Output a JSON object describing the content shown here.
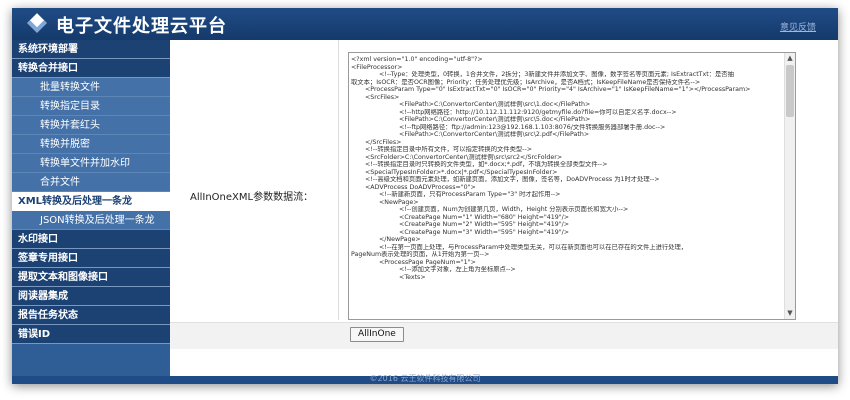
{
  "header": {
    "title": "电子文件处理云平台",
    "feedback_label": "意见反馈"
  },
  "sidebar": {
    "items": [
      {
        "label": "系统环境部署",
        "type": "top"
      },
      {
        "label": "转换合并接口",
        "type": "top"
      },
      {
        "label": "批量转换文件",
        "type": "sub"
      },
      {
        "label": "转换指定目录",
        "type": "sub"
      },
      {
        "label": "转换并套红头",
        "type": "sub"
      },
      {
        "label": "转换并脱密",
        "type": "sub"
      },
      {
        "label": "转换单文件并加水印",
        "type": "sub"
      },
      {
        "label": "合并文件",
        "type": "sub"
      },
      {
        "label": "XML转换及后处理一条龙",
        "type": "active"
      },
      {
        "label": "JSON转换及后处理一条龙",
        "type": "sub"
      },
      {
        "label": "水印接口",
        "type": "top"
      },
      {
        "label": "签章专用接口",
        "type": "top"
      },
      {
        "label": "提取文本和图像接口",
        "type": "top"
      },
      {
        "label": "阅读器集成",
        "type": "top"
      },
      {
        "label": "报告任务状态",
        "type": "top"
      },
      {
        "label": "错误ID",
        "type": "top"
      }
    ]
  },
  "main": {
    "field_label": "AllInOneXML参数数据流：",
    "run_button_label": "AllInOne",
    "xml_lines": [
      "<?xml version=\"1.0\" encoding=\"utf-8\"?>",
      "<FileProcessor>",
      "              <!--Type：处理类型，0转换，1合并文件，2拆分；3新建文件并添加文字、图像，数字签名等页面元素; IsExtractTxt：是否抽",
      "取文本；IsOCR：是否OCR图像；Priority：任务处理优先级；IsArchive，是否A档式；IsKeepFileName是否保持文件名-->",
      "       <ProcessParam Type=\"0\" IsExtractTxt=\"0\" IsOCR=\"0\" Priority=\"4\" IsArchive=\"1\" IsKeepFileName=\"1\"></ProcessParam>",
      "       <SrcFiles>",
      "                        <FilePath>C:\\ConvertorCenter\\测试样例\\src\\1.doc</FilePath>",
      "                        <!--http网络路径：http://10.112.11.112:9120/getmyfile.do?file=你可以自定义名字.docx-->",
      "                        <FilePath>C:\\ConvertorCenter\\测试样例\\src\\5.doc</FilePath>",
      "                        <!--ftp网络路径：ftp://admin:123@192.168.1.103:8076/文件转换服务器部署手册.doc-->",
      "                        <FilePath>C:\\ConvertorCenter\\测试样例\\src\\2.pdf</FilePath>",
      "       </SrcFiles>",
      "       <!--转换指定目录中所有文件，可以指定转换的文件类型-->",
      "       <SrcFolder>C:\\ConvertorCenter\\测试样例\\src\\src2</SrcFolder>",
      "       <!--转换指定目录时只转换的文件类型，如*.docx;*.pdf，不填为转换全部类型文件-->",
      "       <SpecialTypesInFolder>*.docx|*.pdf</SpecialTypesInFolder>",
      "",
      "       <!--高级文档和页面元素处理，如新建页面，添加文字，图像，签名等，DoADVProcess 为1时才处理-->",
      "       <ADVProcess DoADVProcess=\"0\">",
      "              <!--新建新页面，只有ProcessParam Type=\"3\" 时才起作用-->",
      "              <NewPage>",
      "                        <!--创建页面，Num为创建第几页，Width，Height 分别表示页面长和宽大小-->",
      "                        <CreatePage Num=\"1\" Width=\"680\" Height=\"419\"/>",
      "                        <CreatePage Num=\"2\" Width=\"595\" Height=\"419\"/>",
      "                        <CreatePage Num=\"3\" Width=\"595\" Height=\"419\"/>",
      "              </NewPage>",
      "              <!--在第一页面上处理，与ProcessParam中处理类型无关，可以在新页面也可以在已存在的文件上进行处理，",
      "PageNum表示处理的页面，从1开始为第一页-->",
      "              <ProcessPage PageNum=\"1\">",
      "                        <!--添加文字对象，左上角为坐标原点-->",
      "                        <Texts>"
    ]
  },
  "footer": {
    "copyright": "©2016 云王软件科技有限公司"
  }
}
